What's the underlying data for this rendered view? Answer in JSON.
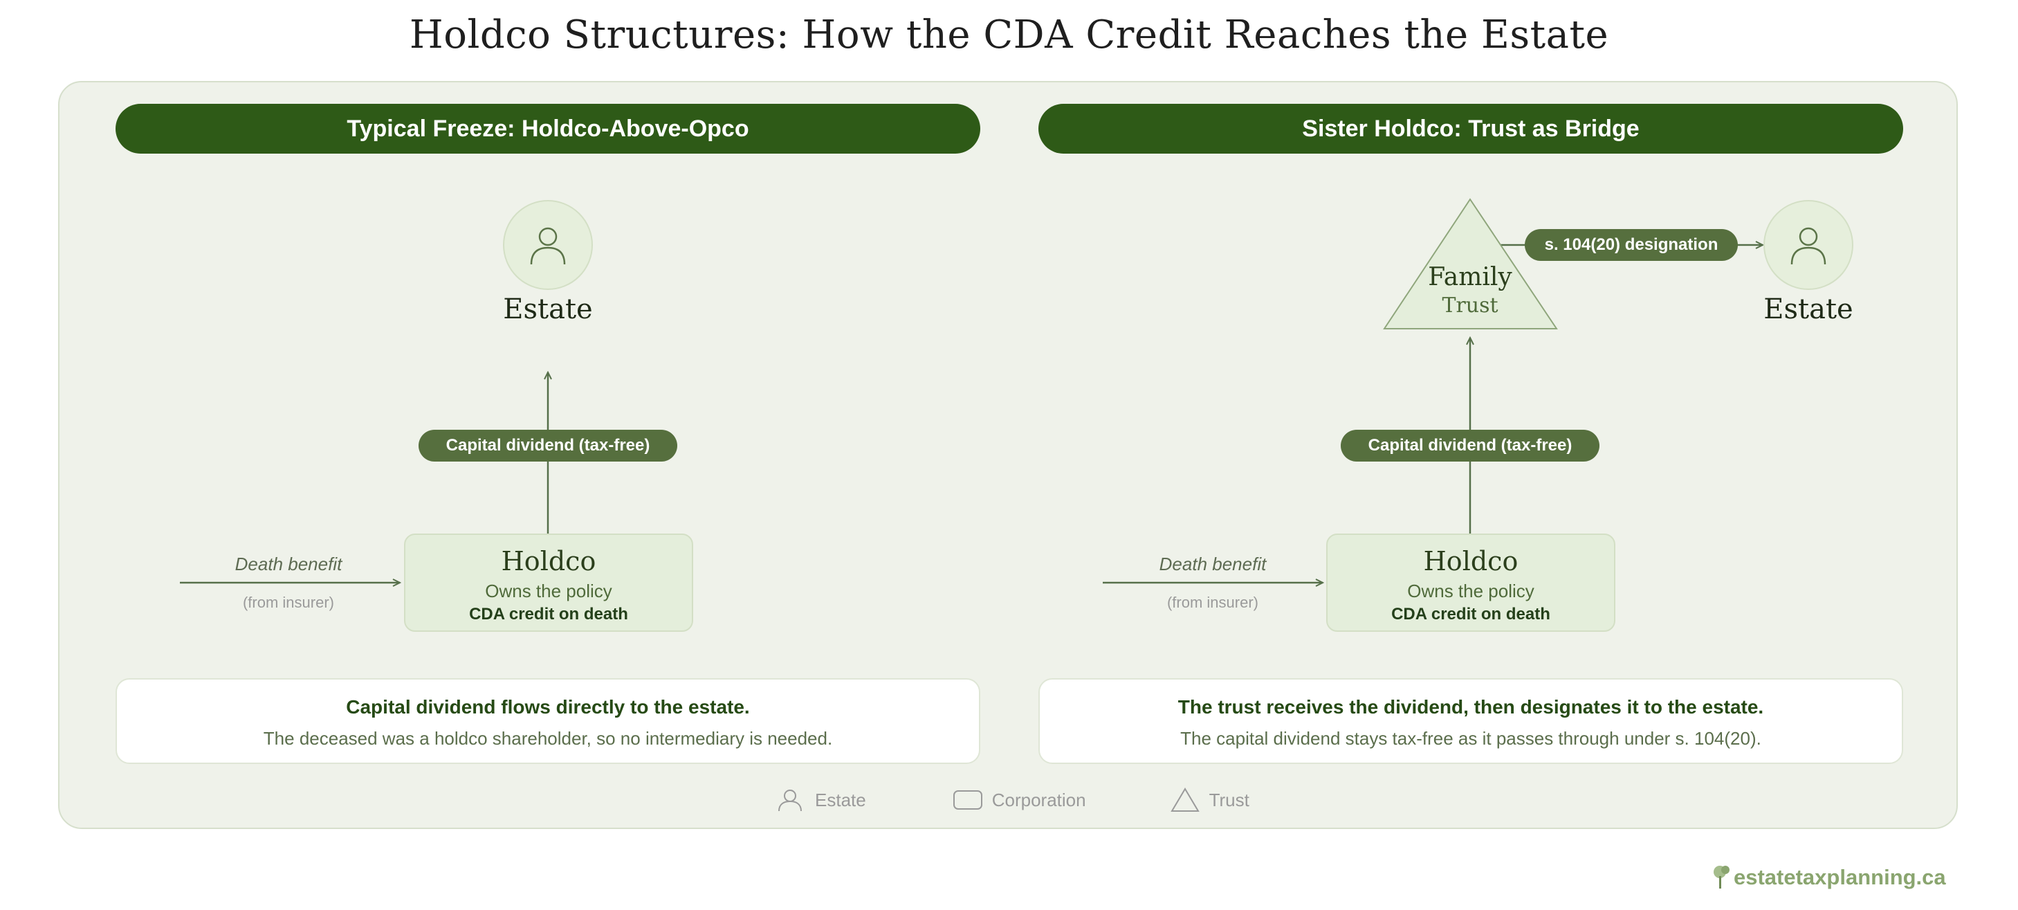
{
  "title": "Holdco Structures: How the CDA Credit Reaches the Estate",
  "left": {
    "header": "Typical Freeze: Holdco-Above-Opco",
    "estate_label": "Estate",
    "dividend_label": "Capital dividend (tax-free)",
    "holdco": {
      "name": "Holdco",
      "line1": "Owns the policy",
      "line2": "CDA credit on death"
    },
    "death_benefit": "Death benefit",
    "from_insurer": "(from insurer)",
    "note_head": "Capital dividend flows directly to the estate.",
    "note_body": "The deceased was a holdco shareholder, so no intermediary is needed."
  },
  "right": {
    "header": "Sister Holdco: Trust as Bridge",
    "trust_line1": "Family",
    "trust_line2": "Trust",
    "designation_label": "s. 104(20) designation",
    "estate_label": "Estate",
    "dividend_label": "Capital dividend (tax-free)",
    "holdco": {
      "name": "Holdco",
      "line1": "Owns the policy",
      "line2": "CDA credit on death"
    },
    "death_benefit": "Death benefit",
    "from_insurer": "(from insurer)",
    "note_head": "The trust receives the dividend, then designates it to the estate.",
    "note_body": "The capital dividend stays tax-free as it passes through under s. 104(20)."
  },
  "legend": [
    {
      "icon": "person-icon",
      "label": "Estate"
    },
    {
      "icon": "rounded-rect-icon",
      "label": "Corporation"
    },
    {
      "icon": "triangle-icon",
      "label": "Trust"
    }
  ],
  "brand": "estatetaxplanning.ca",
  "colors": {
    "header_green": "#2e5a17",
    "pill_green": "#566f3e",
    "panel_bg": "#eff2ea",
    "node_fill": "#e4eedb"
  }
}
